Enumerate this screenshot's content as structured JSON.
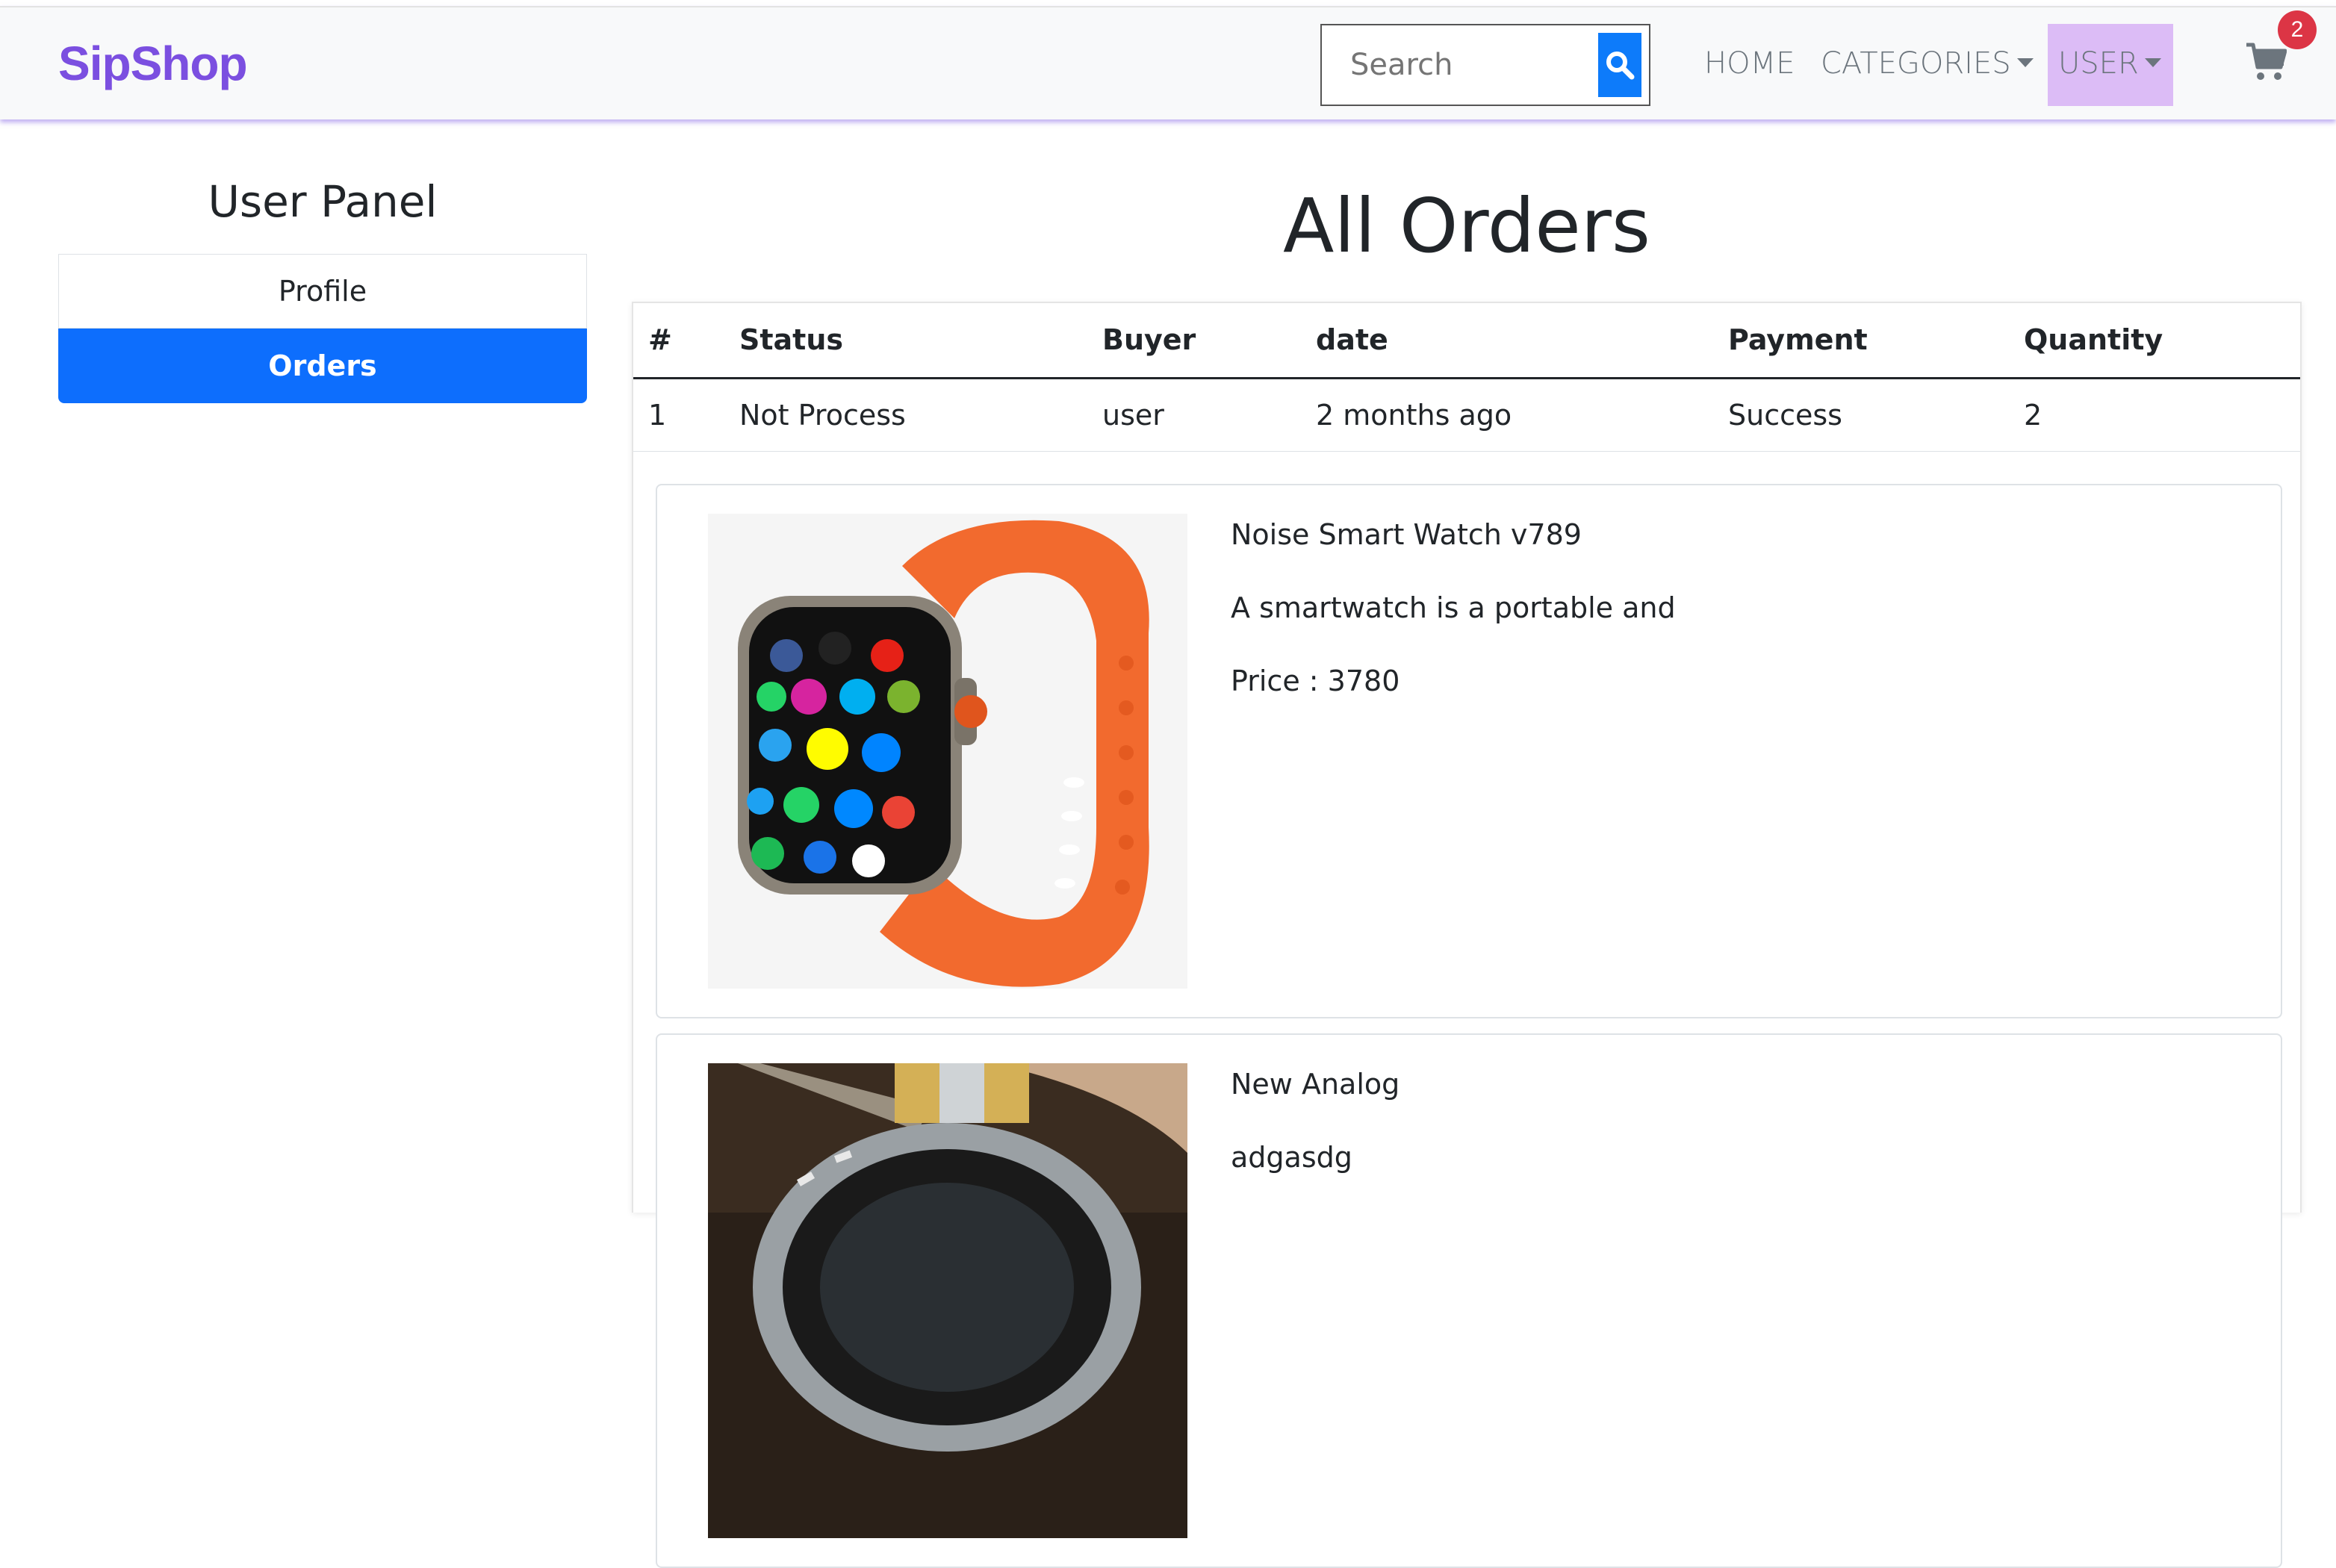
{
  "navbar": {
    "brand": "SipShop",
    "search_placeholder": "Search",
    "links": {
      "home": "HOME",
      "categories": "CATEGORIES",
      "user": "USER"
    },
    "cart_count": "2",
    "colors": {
      "brand": "#7b4fe0",
      "search_button": "#0d7bfa",
      "user_active_bg": "#dcbcf6",
      "badge": "#dc3545"
    },
    "icons": {
      "search": "search-icon",
      "cart": "cart-icon"
    }
  },
  "sidebar": {
    "title": "User Panel",
    "items": [
      {
        "label": "Profile",
        "active": false
      },
      {
        "label": "Orders",
        "active": true
      }
    ],
    "active_color": "#0d6efd"
  },
  "main": {
    "title": "All Orders",
    "table": {
      "headers": [
        "#",
        "Status",
        "Buyer",
        "date",
        "Payment",
        "Quantity"
      ],
      "rows": [
        [
          "1",
          "Not Process",
          "user",
          "2 months ago",
          "Success",
          "2"
        ]
      ]
    },
    "products": [
      {
        "name": "Noise Smart Watch v789",
        "description": "A smartwatch is a portable and",
        "price": "Price : 3780",
        "image": "orange-smartwatch-image"
      },
      {
        "name": "New Analog",
        "description": "adgasdg",
        "image": "analog-watch-image"
      }
    ]
  }
}
